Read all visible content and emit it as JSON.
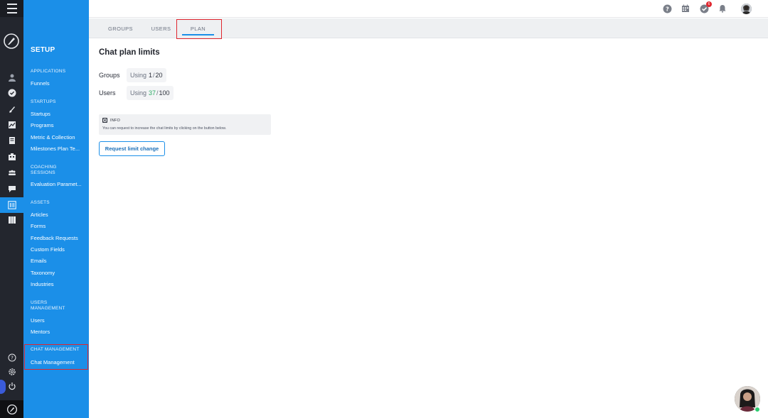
{
  "sidebar": {
    "title": "SETUP",
    "sections": [
      {
        "heading": "APPLICATIONS",
        "items": [
          "Funnels"
        ]
      },
      {
        "heading": "STARTUPS",
        "items": [
          "Startups",
          "Programs",
          "Metric & Collection",
          "Milestones Plan Te..."
        ]
      },
      {
        "heading": "COACHING SESSIONS",
        "items": [
          "Evaluation Paramet..."
        ]
      },
      {
        "heading": "ASSETS",
        "items": [
          "Articles",
          "Forms",
          "Feedback Requests",
          "Custom Fields",
          "Emails",
          "Taxonomy",
          "Industries"
        ]
      },
      {
        "heading": "USERS MANAGEMENT",
        "items": [
          "Users",
          "Mentors"
        ]
      },
      {
        "heading": "CHAT MANAGEMENT",
        "items": [
          "Chat Management"
        ]
      }
    ]
  },
  "rail": {
    "icons": [
      "menu-icon",
      "rocket-logo-icon",
      "user-icon",
      "check-circle-icon",
      "rocket-icon",
      "chart-icon",
      "document-icon",
      "building-icon",
      "team-icon",
      "chat-icon",
      "settings-sliders-icon",
      "grid-icon",
      "help-icon",
      "gear-icon",
      "power-icon"
    ]
  },
  "header": {
    "notification_count": "6",
    "icons": [
      "help-icon",
      "calendar-icon",
      "task-check-icon",
      "bell-icon",
      "avatar"
    ]
  },
  "tabs": [
    {
      "label": "GROUPS"
    },
    {
      "label": "USERS"
    },
    {
      "label": "PLAN"
    }
  ],
  "main": {
    "title": "Chat plan limits",
    "limits": [
      {
        "label": "Groups",
        "prefix": "Using",
        "used": "1",
        "sep": "/",
        "total": "20"
      },
      {
        "label": "Users",
        "prefix": "Using",
        "used": "37",
        "sep": "/",
        "total": "100"
      }
    ],
    "info": {
      "heading": "INFO",
      "text": "You can request to increase the chat limits by clicking on the button below."
    },
    "request_button": "Request limit change"
  },
  "colors": {
    "accent": "#1b8fe8",
    "rail": "#23262e",
    "highlight": "#e0262e",
    "used_green": "#2eab67"
  }
}
